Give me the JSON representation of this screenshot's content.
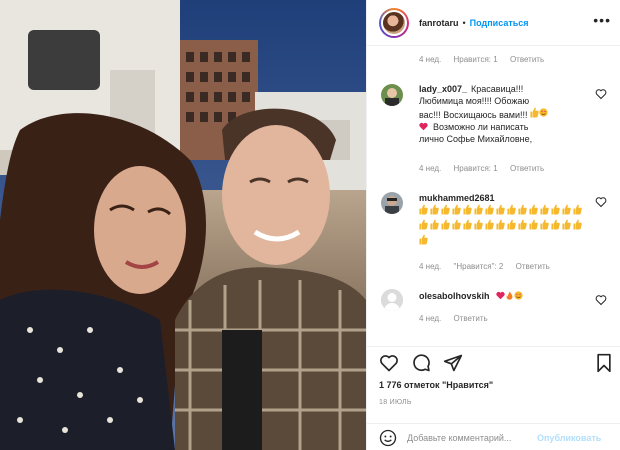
{
  "post": {
    "photo_description": "selfie",
    "author": "fanrotaru",
    "separator": "•",
    "follow_label": "Подписаться",
    "more_label": "•••"
  },
  "comments": {
    "first_meta": {
      "time": "4 нед.",
      "likes": "Нравится: 1",
      "reply": "Ответить"
    },
    "items": [
      {
        "username": "lady_x007_",
        "lines": [
          "Красавица!!!",
          "Любимица моя!!!! Обожаю",
          "вас!!! Восхищаюсь вами!!!",
          "Возможно ли написать",
          "лично Софье Михайловне,"
        ],
        "time": "4 нед.",
        "likes": "Нравится: 1",
        "reply": "Ответить"
      },
      {
        "username": "mukhammed2681",
        "thumbs_count": 31,
        "time": "4 нед.",
        "likes": "\"Нравится\": 2",
        "reply": "Ответить"
      },
      {
        "username": "olesabolhovskih",
        "time": "4 нед.",
        "reply": "Ответить"
      }
    ]
  },
  "stats": {
    "likes_label": "1 776 отметок \"Нравится\"",
    "date": "18 ИЮЛЬ"
  },
  "add_comment": {
    "placeholder": "Добавьте комментарий...",
    "publish_label": "Опубликовать"
  },
  "icons": [
    "heart-icon",
    "comment-icon",
    "share-icon",
    "bookmark-icon",
    "emoji-icon",
    "more-icon"
  ],
  "colors": {
    "link": "#0095f6",
    "muted": "#8e8e8e",
    "text": "#262626",
    "publish_disabled": "#b2dffc"
  }
}
